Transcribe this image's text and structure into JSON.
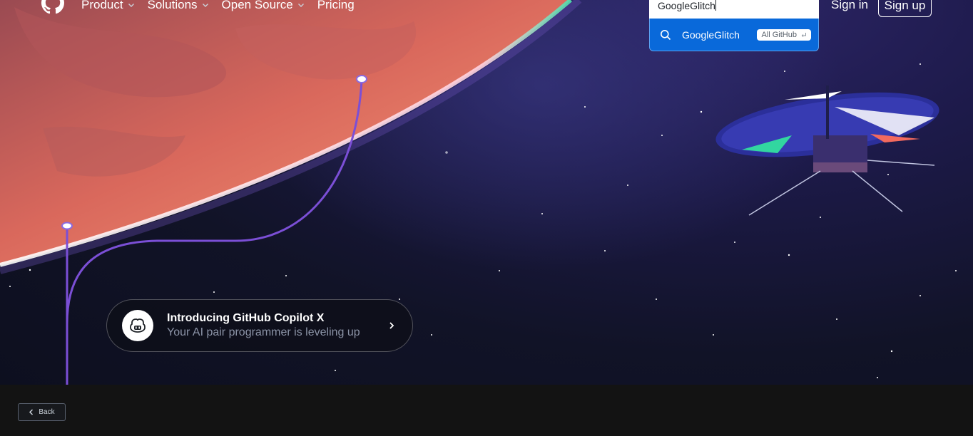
{
  "nav": {
    "items": [
      {
        "label": "Product",
        "has_dropdown": true
      },
      {
        "label": "Solutions",
        "has_dropdown": true
      },
      {
        "label": "Open Source",
        "has_dropdown": true
      },
      {
        "label": "Pricing",
        "has_dropdown": false
      }
    ]
  },
  "search": {
    "value": "GoogleGlitch",
    "suggestion": {
      "icon": "search-icon",
      "text": "GoogleGlitch",
      "scope": "All GitHub",
      "enter_icon": "return-icon"
    }
  },
  "auth": {
    "sign_in": "Sign in",
    "sign_up": "Sign up"
  },
  "promo": {
    "icon": "copilot-icon",
    "title": "Introducing GitHub Copilot X",
    "subtitle": "Your AI pair programmer is leveling up"
  },
  "footer": {
    "back_label": "Back"
  },
  "colors": {
    "suggestion_bg": "#0969da",
    "planet": "#e8735f",
    "trail": "#7b4fd6",
    "bottom_bar": "#131313"
  }
}
